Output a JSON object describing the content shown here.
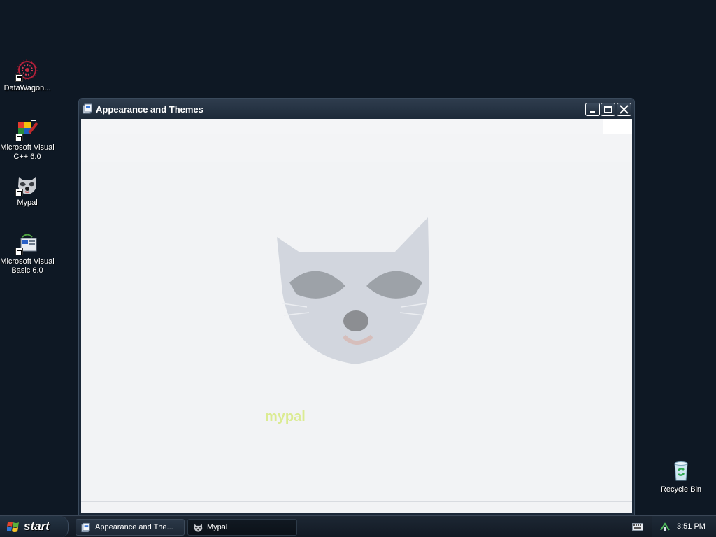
{
  "desktop": {
    "icons": [
      {
        "label": "DataWagon...",
        "icon": "datawagon-icon"
      },
      {
        "label": "Microsoft Visual C++ 6.0",
        "icon": "visual-cpp-icon"
      },
      {
        "label": "Mypal",
        "icon": "mypal-raccoon-icon"
      },
      {
        "label": "Microsoft Visual Basic 6.0",
        "icon": "visual-basic-icon"
      },
      {
        "label": "Recycle Bin",
        "icon": "recycle-bin-icon"
      }
    ]
  },
  "window": {
    "title": "Appearance and Themes",
    "watermark_text": "mypal"
  },
  "taskbar": {
    "start_label": "start",
    "tasks": [
      {
        "label": "Appearance and The...",
        "active": false
      },
      {
        "label": "Mypal",
        "active": true
      }
    ],
    "clock": "3:51 PM"
  },
  "colors": {
    "desktop_bg": "#0e1824",
    "window_frame": "#1b2838",
    "client_bg": "#f2f3f5"
  }
}
